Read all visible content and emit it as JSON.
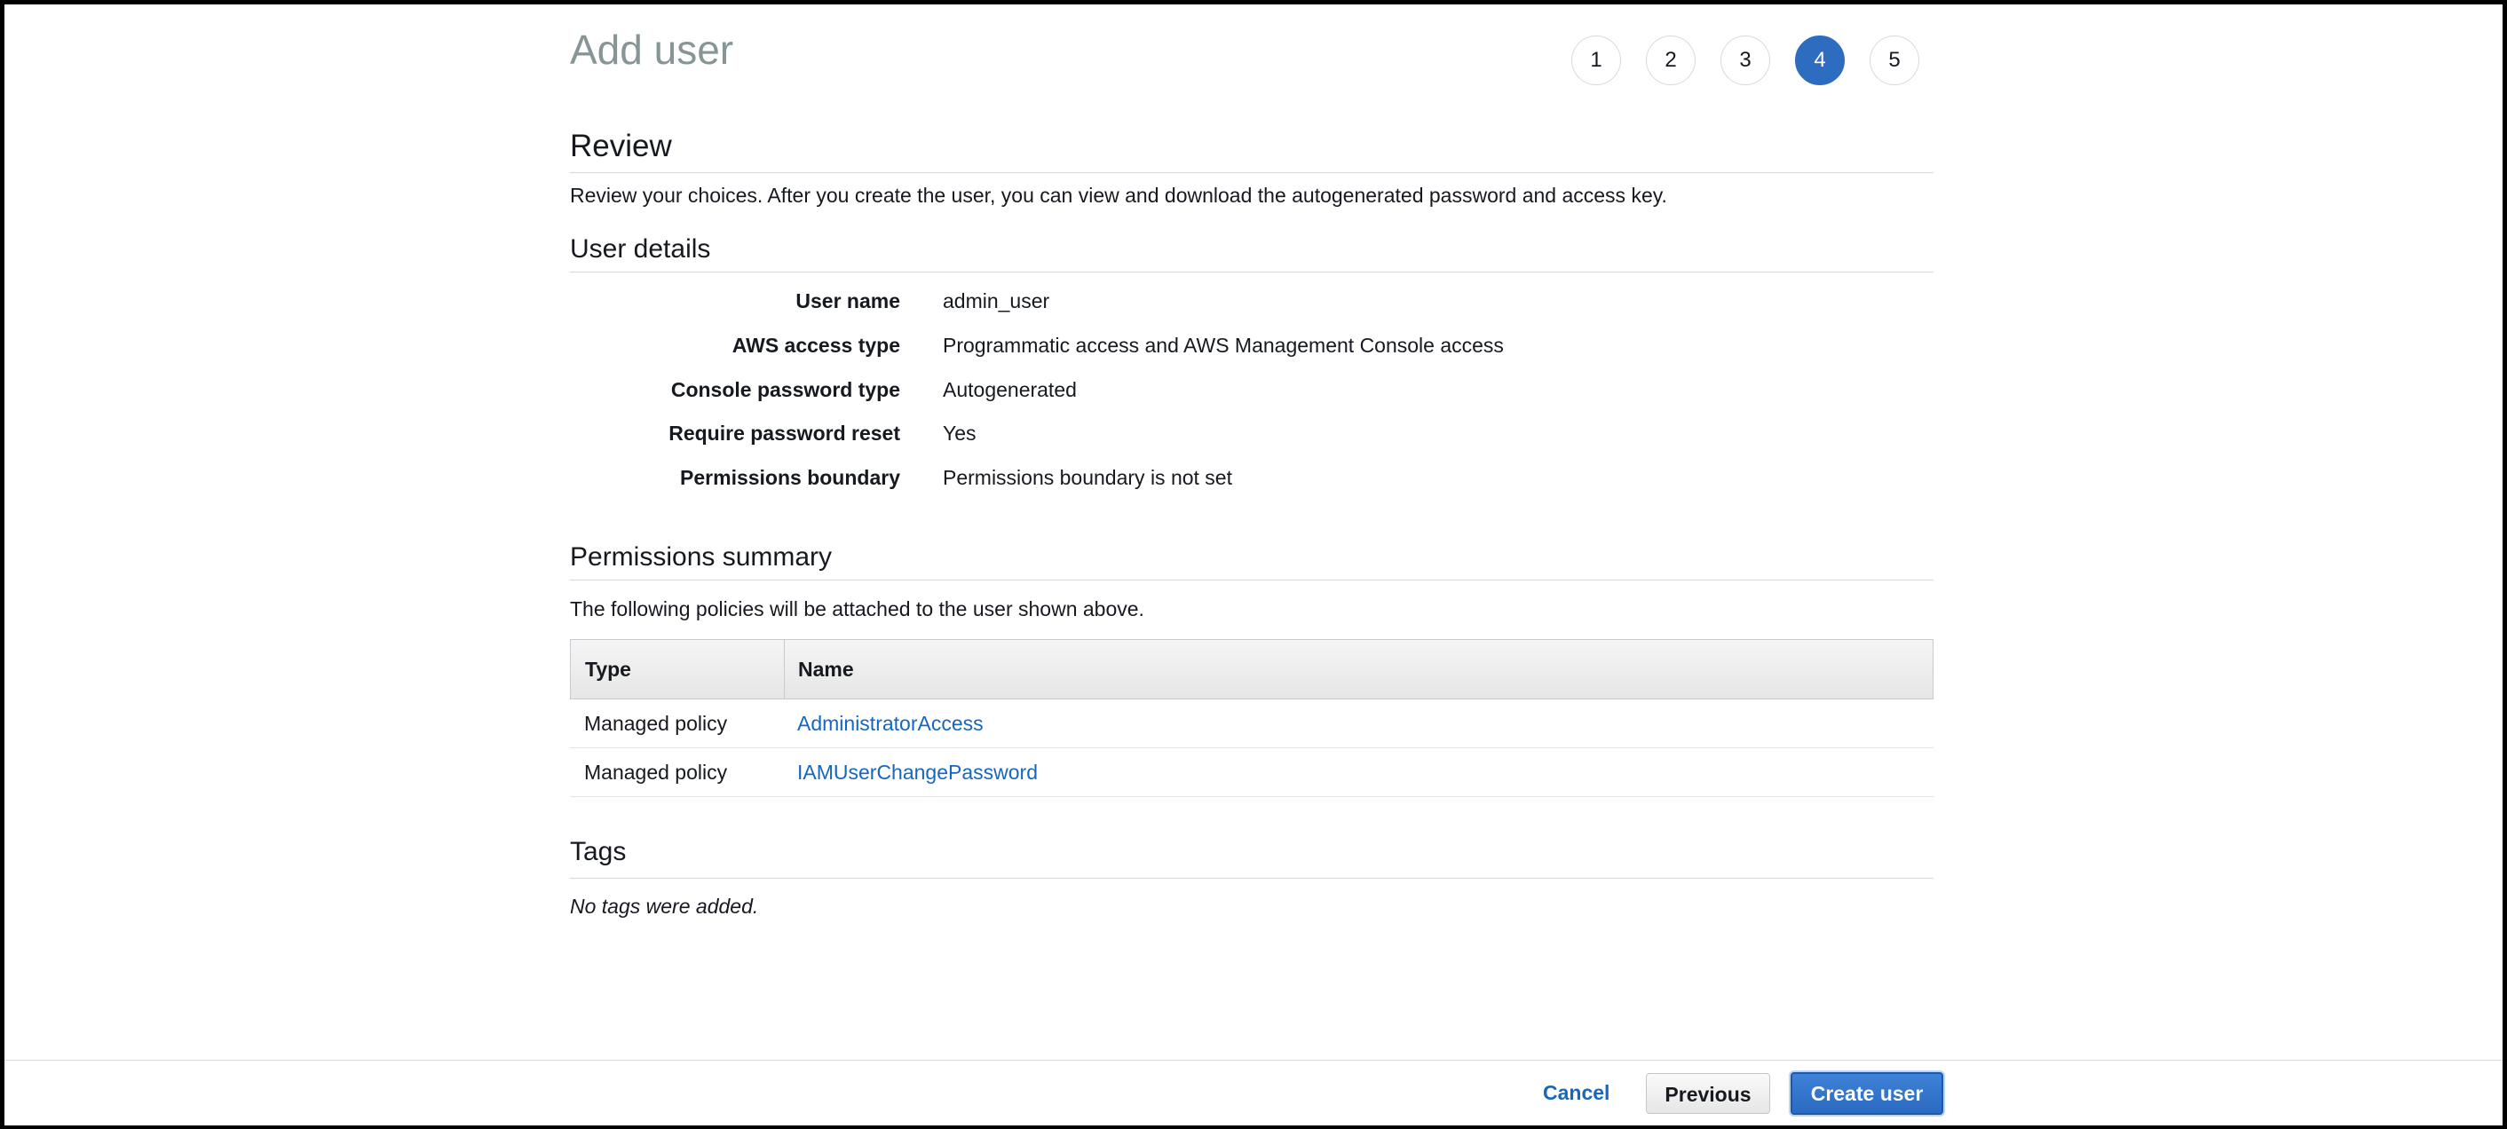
{
  "page": {
    "title": "Add user"
  },
  "steps": [
    {
      "label": "1",
      "active": false
    },
    {
      "label": "2",
      "active": false
    },
    {
      "label": "3",
      "active": false
    },
    {
      "label": "4",
      "active": true
    },
    {
      "label": "5",
      "active": false
    }
  ],
  "review": {
    "heading": "Review",
    "description": "Review your choices. After you create the user, you can view and download the autogenerated password and access key."
  },
  "user_details": {
    "heading": "User details",
    "rows": [
      {
        "label": "User name",
        "value": "admin_user"
      },
      {
        "label": "AWS access type",
        "value": "Programmatic access and AWS Management Console access"
      },
      {
        "label": "Console password type",
        "value": "Autogenerated"
      },
      {
        "label": "Require password reset",
        "value": "Yes"
      },
      {
        "label": "Permissions boundary",
        "value": "Permissions boundary is not set"
      }
    ]
  },
  "permissions": {
    "heading": "Permissions summary",
    "description": "The following policies will be attached to the user shown above.",
    "columns": {
      "type": "Type",
      "name": "Name"
    },
    "rows": [
      {
        "type": "Managed policy",
        "name": "AdministratorAccess"
      },
      {
        "type": "Managed policy",
        "name": "IAMUserChangePassword"
      }
    ]
  },
  "tags": {
    "heading": "Tags",
    "empty_text": "No tags were added."
  },
  "footer": {
    "cancel_label": "Cancel",
    "previous_label": "Previous",
    "create_label": "Create user"
  },
  "colors": {
    "accent": "#2e6cc0",
    "link": "#1766c0",
    "title_gray": "#879596"
  }
}
